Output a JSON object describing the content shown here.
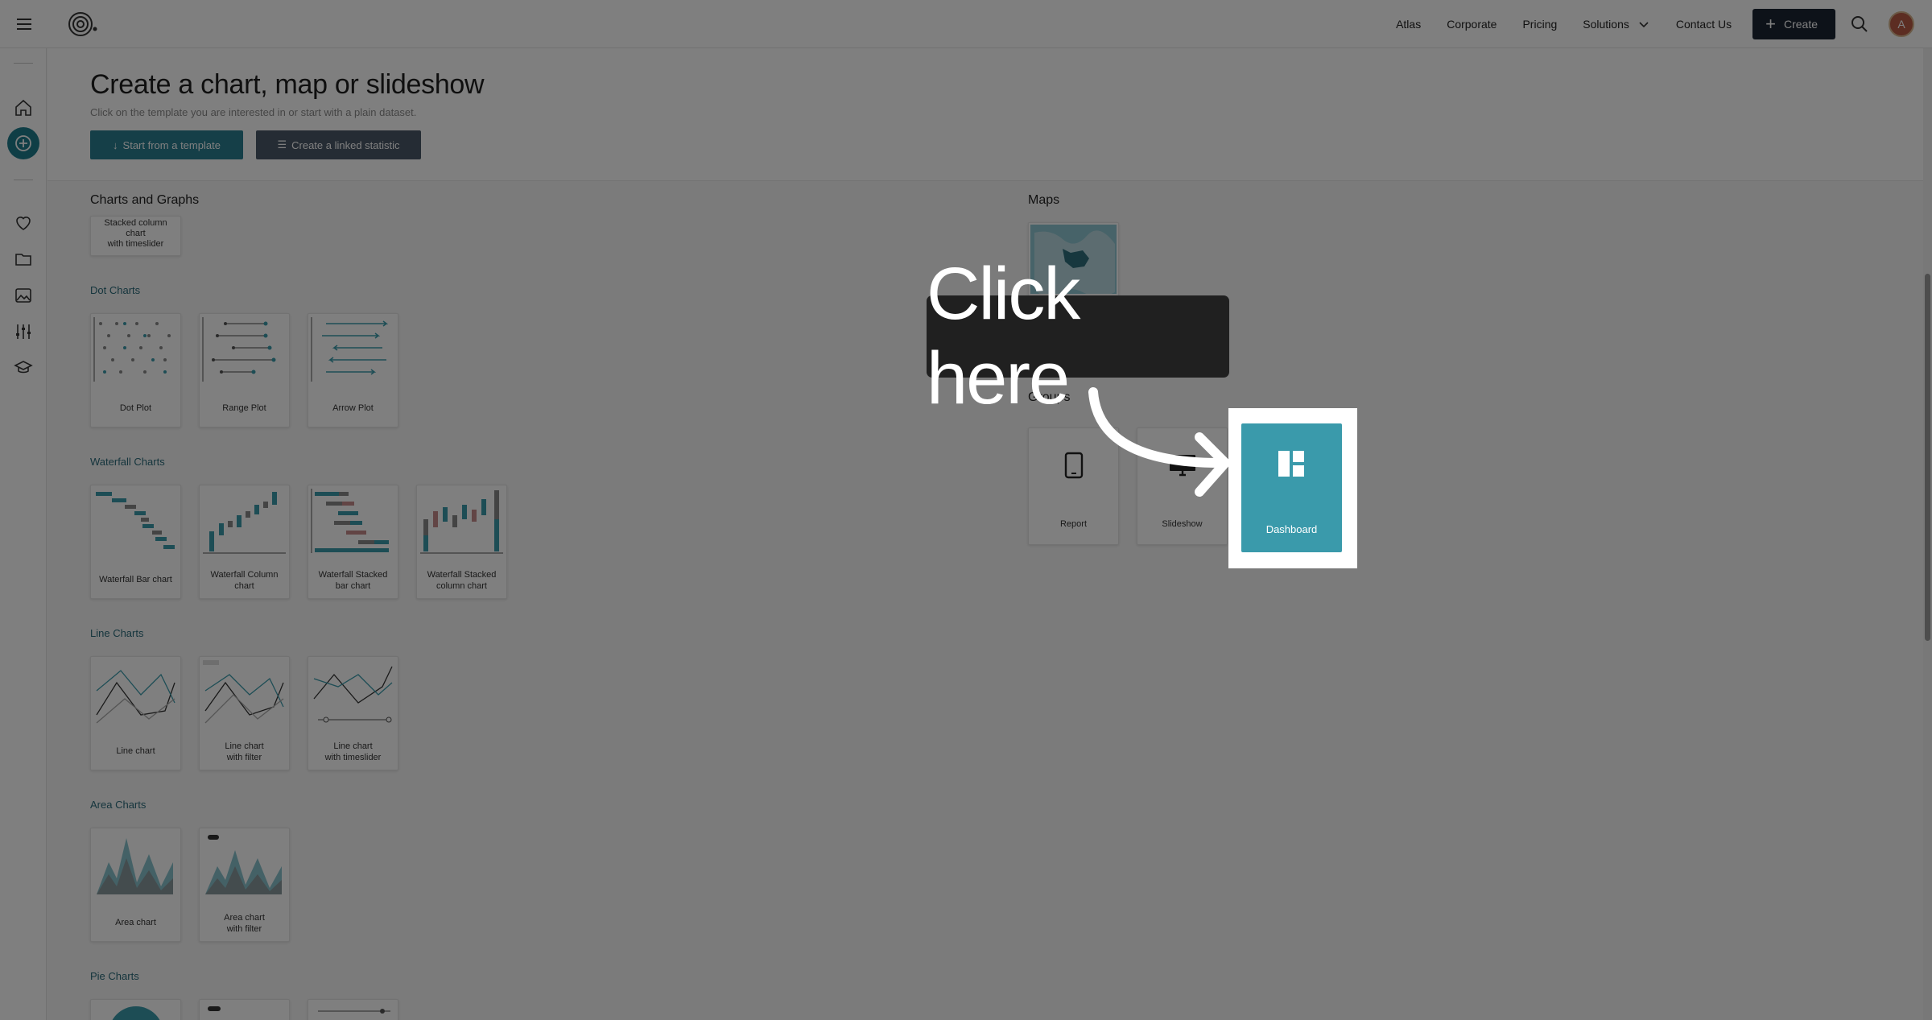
{
  "topbar": {
    "nav": [
      "Atlas",
      "Corporate",
      "Pricing",
      "Solutions",
      "Contact Us"
    ],
    "create_label": "Create",
    "avatar_initial": "A"
  },
  "hero": {
    "title": "Create a chart, map or slideshow",
    "subtitle": "Click on the template you are interested in or start with a plain dataset.",
    "template_button": "Start from a template",
    "linked_button": "Create a linked statistic"
  },
  "charts": {
    "section_title": "Charts and Graphs",
    "partial_card_label": "Stacked column\nchart\nwith timeslider",
    "categories": {
      "dot": {
        "title": "Dot Charts",
        "items": [
          "Dot Plot",
          "Range Plot",
          "Arrow Plot"
        ]
      },
      "waterfall": {
        "title": "Waterfall Charts",
        "items": [
          "Waterfall Bar chart",
          "Waterfall Column\nchart",
          "Waterfall Stacked\nbar chart",
          "Waterfall Stacked\ncolumn chart"
        ]
      },
      "line": {
        "title": "Line Charts",
        "items": [
          "Line chart",
          "Line chart\nwith filter",
          "Line chart\nwith timeslider"
        ]
      },
      "area": {
        "title": "Area Charts",
        "items": [
          "Area chart",
          "Area chart\nwith filter"
        ]
      },
      "pie": {
        "title": "Pie Charts"
      }
    }
  },
  "maps": {
    "section_title": "Maps"
  },
  "groups": {
    "section_title": "Groups",
    "items": [
      "Report",
      "Slideshow",
      "Dashboard"
    ]
  },
  "overlay": {
    "callout_text": "Click here"
  },
  "colors": {
    "accent": "#2a7f90",
    "dark": "#1a2533",
    "dashboard": "#3a9aab"
  }
}
